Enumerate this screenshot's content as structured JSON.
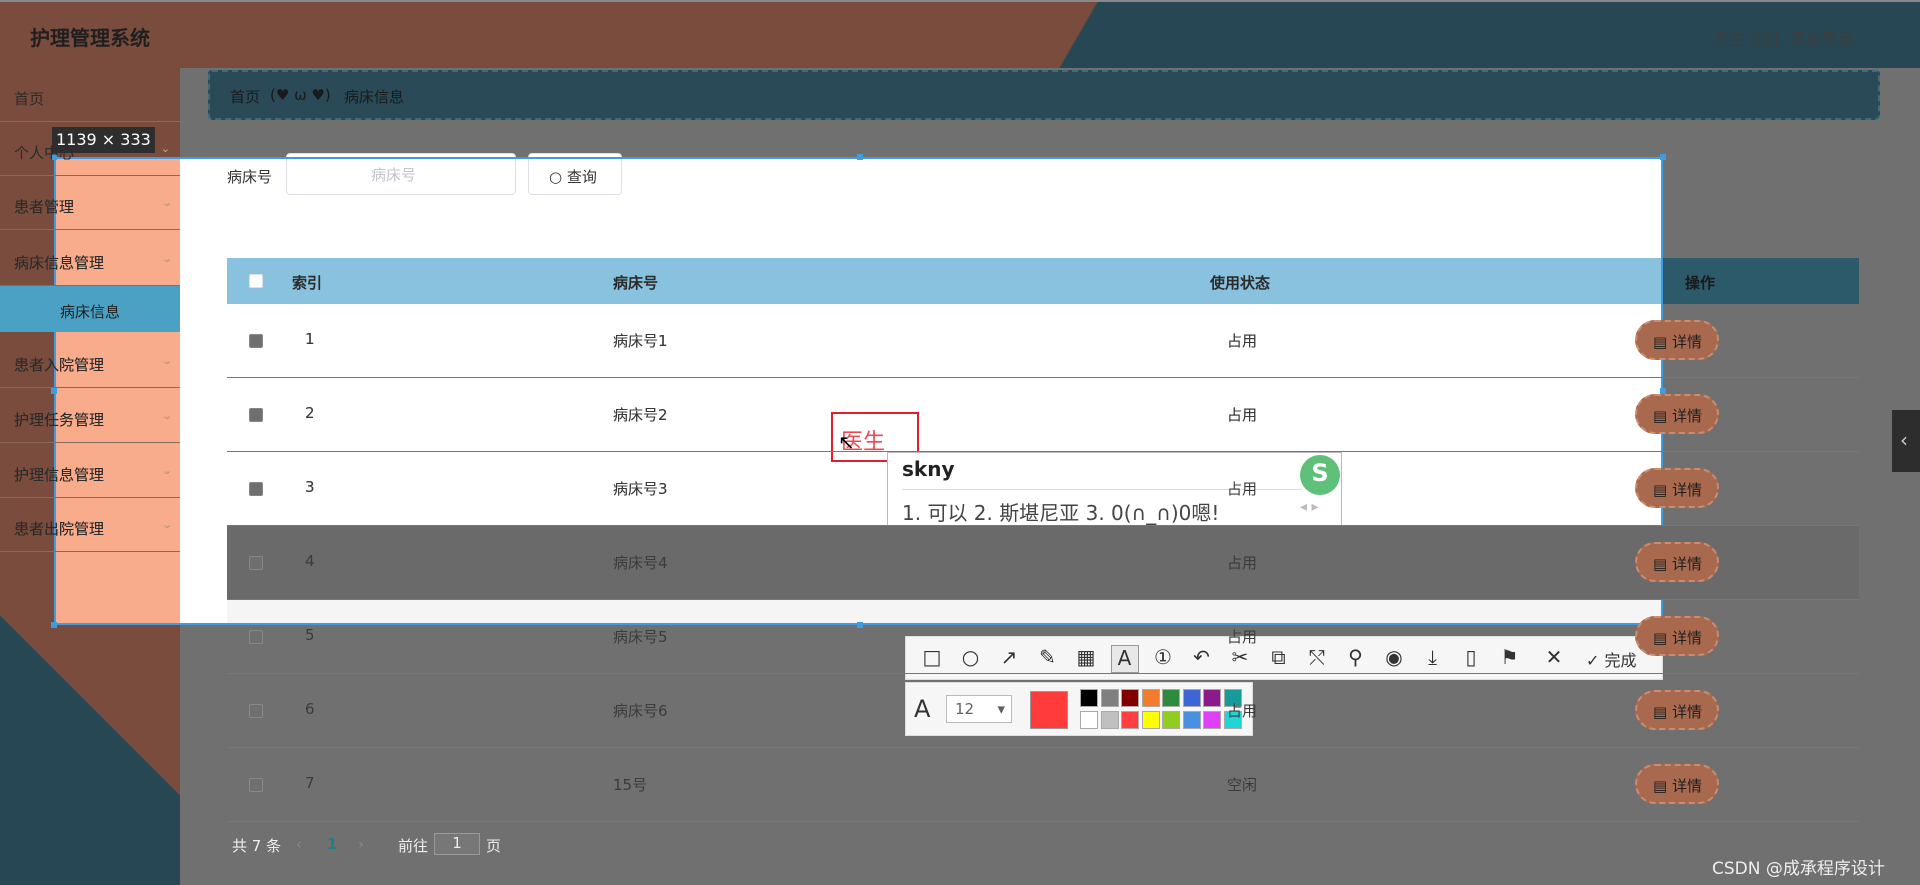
{
  "header": {
    "title": "护理管理系统",
    "user": "医生 001",
    "logout": "退出登录"
  },
  "sidebar": {
    "items": [
      "首页",
      "个人中心",
      "患者管理",
      "病床信息管理",
      "患者入院管理",
      "护理任务管理",
      "护理信息管理",
      "患者出院管理"
    ],
    "sub_active": "病床信息"
  },
  "breadcrumb": {
    "home": "首页",
    "sep": "(♥ ω ♥)",
    "current": "病床信息"
  },
  "selection": {
    "dimensions": "1139 × 333"
  },
  "search": {
    "label": "病床号",
    "placeholder": "病床号",
    "button": "查询"
  },
  "table": {
    "headers": {
      "index": "索引",
      "bed": "病床号",
      "status": "使用状态",
      "action": "操作"
    },
    "rows": [
      {
        "index": "1",
        "bed": "病床号1",
        "status": "占用"
      },
      {
        "index": "2",
        "bed": "病床号2",
        "status": "占用"
      },
      {
        "index": "3",
        "bed": "病床号3",
        "status": "占用"
      },
      {
        "index": "4",
        "bed": "病床号4",
        "status": "占用"
      },
      {
        "index": "5",
        "bed": "病床号5",
        "status": "占用"
      },
      {
        "index": "6",
        "bed": "病床号6",
        "status": "占用"
      },
      {
        "index": "7",
        "bed": "15号",
        "status": "空闲"
      }
    ],
    "detail_label": "详情"
  },
  "pager": {
    "total": "共 7 条",
    "page": "1",
    "goto": "前往",
    "goto_value": "1",
    "page_unit": "页"
  },
  "annotation": {
    "text": "医生"
  },
  "ime": {
    "code": "skny",
    "candidates": "1. 可以  2. 斯堪尼亚  3. 0(∩_∩)0嗯!",
    "logo": "S"
  },
  "screenshot_toolbar": {
    "done": "完成",
    "font_size": "12",
    "colors": [
      "#000000",
      "#808080",
      "#800000",
      "#f27c2b",
      "#2e8b3d",
      "#3e64d6",
      "#8b1a8b",
      "#169a9a",
      "#ffffff",
      "#c0c0c0",
      "#ff4040",
      "#ffff00",
      "#8fce1e",
      "#4a90e2",
      "#e040fb",
      "#1fd6d6"
    ],
    "current_color": "#ff3b3b"
  },
  "watermark": "CSDN @成承程序设计"
}
